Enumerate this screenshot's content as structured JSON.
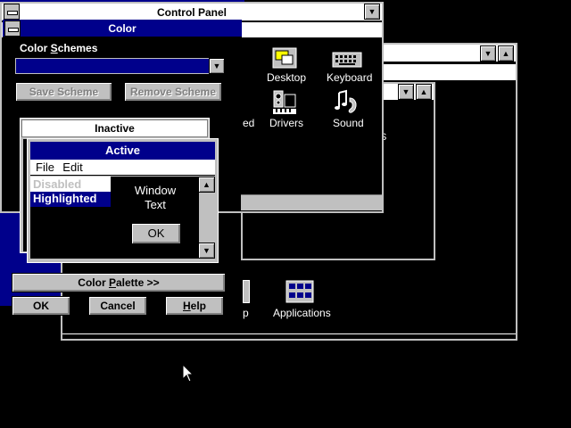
{
  "control_panel": {
    "title": "Control Panel",
    "icons": [
      {
        "label": "Desktop",
        "icon": "desktop-icon"
      },
      {
        "label": "Keyboard",
        "icon": "keyboard-icon"
      },
      {
        "label": "ed",
        "icon": "partial-icon"
      },
      {
        "label": "Drivers",
        "icon": "drivers-icon"
      },
      {
        "label": "Sound",
        "icon": "sound-icon"
      }
    ]
  },
  "program_manager": {
    "icons": [
      {
        "label": "Applications",
        "icon": "applications-group-icon"
      },
      {
        "label": "p",
        "icon": "partial-group-icon"
      }
    ],
    "partial_text": "S"
  },
  "color_dialog": {
    "title": "Color",
    "schemes_label_pre": "Color ",
    "schemes_label_u": "S",
    "schemes_label_post": "chemes",
    "scheme_value": "",
    "save_scheme": "Save Scheme",
    "remove_scheme": "Remove Scheme",
    "preview": {
      "inactive_title": "Inactive",
      "active_title": "Active",
      "menu_file": "File",
      "menu_edit": "Edit",
      "disabled_text": "Disabled",
      "highlighted_text": "Highlighted",
      "window_text_1": "Window",
      "window_text_2": "Text",
      "ok": "OK"
    },
    "color_palette_pre": "Color ",
    "color_palette_u": "P",
    "color_palette_post": "alette >>",
    "ok": "OK",
    "cancel": "Cancel",
    "help_u": "H",
    "help_post": "elp"
  },
  "colors": {
    "active_title": "#00008b",
    "highlight": "#00008b",
    "face": "#c0c0c0",
    "desktop": "#000000"
  }
}
